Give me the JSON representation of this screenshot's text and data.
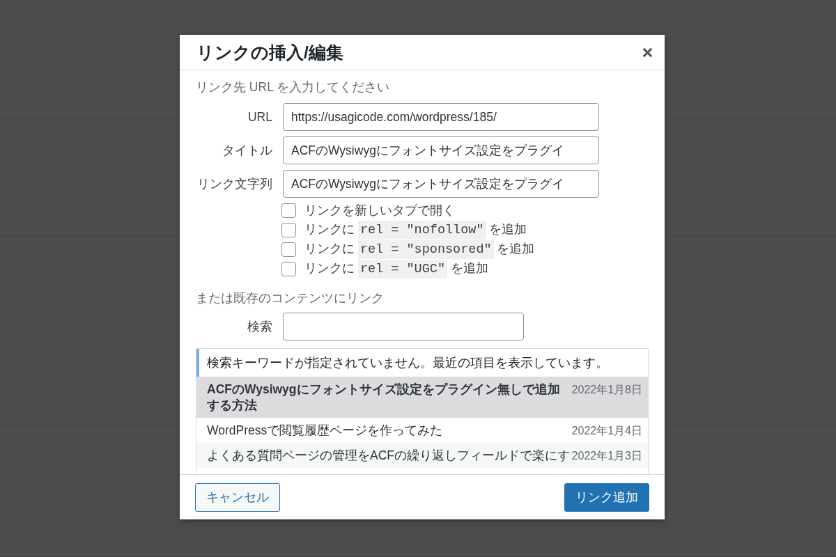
{
  "dialog": {
    "title": "リンクの挿入/編集"
  },
  "url_section": {
    "heading": "リンク先 URL を入力してください",
    "fields": [
      {
        "label": "URL",
        "value": "https://usagicode.com/wordpress/185/"
      },
      {
        "label": "タイトル",
        "value": "ACFのWysiwygにフォントサイズ設定をプラグイ"
      },
      {
        "label": "リンク文字列",
        "value": "ACFのWysiwygにフォントサイズ設定をプラグイ"
      }
    ],
    "options": [
      {
        "checked": false,
        "parts": [
          {
            "kind": "text",
            "text": "リンクを新しいタブで開く"
          }
        ]
      },
      {
        "checked": false,
        "parts": [
          {
            "kind": "text",
            "text": "リンクに"
          },
          {
            "kind": "code",
            "text": "rel = \"nofollow\""
          },
          {
            "kind": "text",
            "text": "を追加"
          }
        ]
      },
      {
        "checked": false,
        "parts": [
          {
            "kind": "text",
            "text": "リンクに"
          },
          {
            "kind": "code",
            "text": "rel = \"sponsored\""
          },
          {
            "kind": "text",
            "text": "を追加"
          }
        ]
      },
      {
        "checked": false,
        "parts": [
          {
            "kind": "text",
            "text": "リンクに"
          },
          {
            "kind": "code",
            "text": "rel = \"UGC\""
          },
          {
            "kind": "text",
            "text": "を追加"
          }
        ]
      }
    ]
  },
  "existing_section": {
    "heading": "または既存のコンテンツにリンク",
    "search": {
      "label": "検索"
    },
    "notice": "検索キーワードが指定されていません。最近の項目を表示しています。",
    "results": [
      {
        "title": "ACFのWysiwygにフォントサイズ設定をプラグイン無しで追加する方法",
        "date": "2022年1月8日",
        "selected": true
      },
      {
        "title": "WordPressで閲覧履歴ページを作ってみた",
        "date": "2022年1月4日",
        "selected": false
      },
      {
        "title": "よくある質問ページの管理をACFの繰り返しフィールドで楽にす",
        "date": "2022年1月3日",
        "selected": false
      }
    ]
  },
  "buttons": [
    {
      "kind": "secondary",
      "label": "キャンセル"
    },
    {
      "kind": "primary",
      "label": "リンク追加"
    }
  ]
}
